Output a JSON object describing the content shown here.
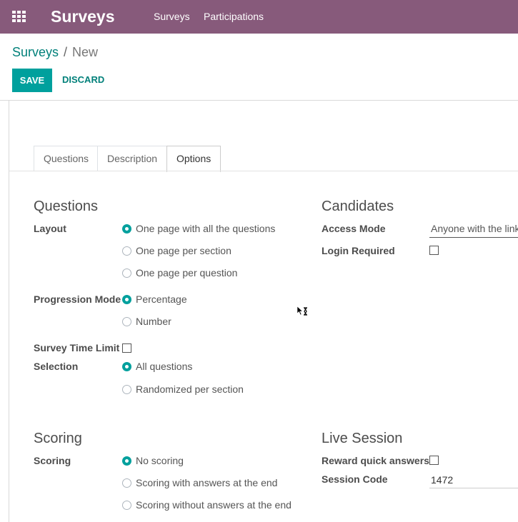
{
  "navbar": {
    "brand": "Surveys",
    "menu": [
      "Surveys",
      "Participations"
    ]
  },
  "breadcrumb": {
    "parent": "Surveys",
    "separator": "/",
    "current": "New"
  },
  "buttons": {
    "save": "SAVE",
    "discard": "DISCARD"
  },
  "tabs": [
    {
      "label": "Questions",
      "active": false
    },
    {
      "label": "Description",
      "active": false
    },
    {
      "label": "Options",
      "active": true
    }
  ],
  "questions": {
    "title": "Questions",
    "layout": {
      "label": "Layout",
      "options": [
        "One page with all the questions",
        "One page per section",
        "One page per question"
      ],
      "selected": "One page with all the questions"
    },
    "progression": {
      "label": "Progression Mode",
      "options": [
        "Percentage",
        "Number"
      ],
      "selected": "Percentage"
    },
    "time_limit": {
      "label": "Survey Time Limit",
      "checked": false
    },
    "selection": {
      "label": "Selection",
      "options": [
        "All questions",
        "Randomized per section"
      ],
      "selected": "All questions"
    }
  },
  "candidates": {
    "title": "Candidates",
    "access_mode": {
      "label": "Access Mode",
      "value": "Anyone with the link"
    },
    "login_required": {
      "label": "Login Required",
      "checked": false
    }
  },
  "scoring": {
    "title": "Scoring",
    "label": "Scoring",
    "options": [
      "No scoring",
      "Scoring with answers at the end",
      "Scoring without answers at the end"
    ],
    "selected": "No scoring"
  },
  "live_session": {
    "title": "Live Session",
    "reward": {
      "label": "Reward quick answers",
      "checked": false
    },
    "session_code": {
      "label": "Session Code",
      "value": "1472"
    }
  },
  "colors": {
    "navbar": "#875a7b",
    "primary": "#00a09d",
    "link": "#01807a"
  }
}
